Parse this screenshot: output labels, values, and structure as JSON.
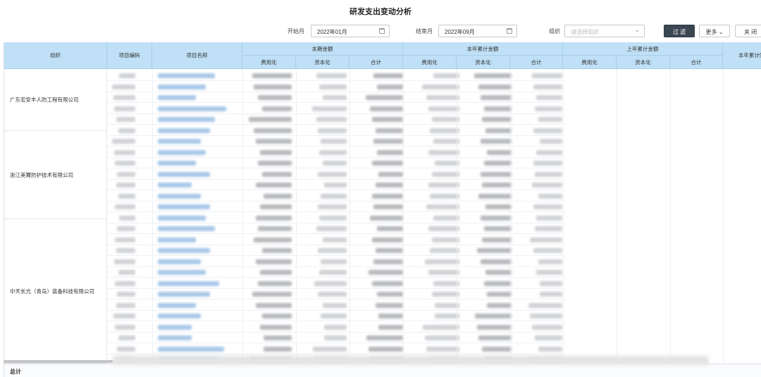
{
  "title": "研发支出变动分析",
  "filters": {
    "start_label": "开始月",
    "start_value": "2022年01月",
    "end_label": "结束月",
    "end_value": "2022年09月",
    "org_label": "组织",
    "org_placeholder": "请选择组织",
    "filter_btn": "过 滤",
    "more_btn": "更多",
    "close_btn": "关 闭"
  },
  "table": {
    "headers": {
      "org": "组织",
      "code": "项目编码",
      "name": "项目名称",
      "current": "本期金额",
      "ytd": "本年累计金额",
      "last_ytd": "上年累计金额",
      "ytd_yoy": "本年累计同比",
      "expensed": "费用化",
      "capitalized": "资本化",
      "total": "合计"
    },
    "orgs": [
      "广东宏安丰人防工程有限公司",
      "浙江美寶防护技术有限公司",
      "中天长光（青岛）装备科技有限公司"
    ],
    "total_label": "总计"
  },
  "icons": {
    "calendar": "calendar-icon",
    "dropdown": "chevron-down-icon"
  },
  "colors": {
    "header_bg": "#bfe0f6",
    "filter_button": "#3a4652"
  }
}
